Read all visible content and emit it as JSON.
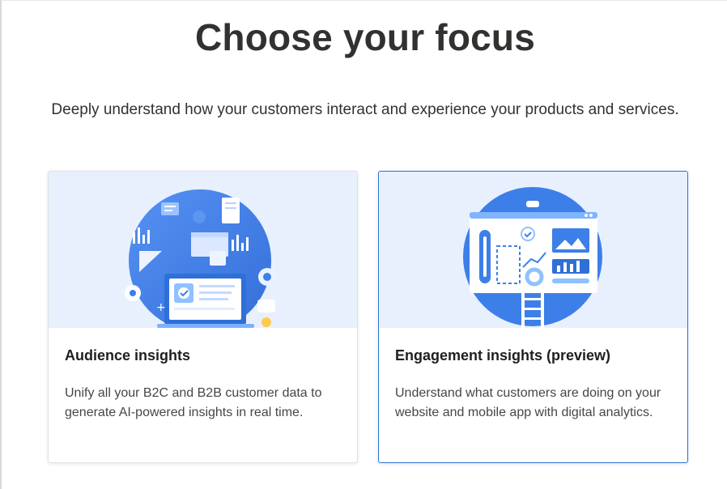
{
  "header": {
    "title": "Choose your focus",
    "subtitle": "Deeply understand how your customers interact and experience your products and services."
  },
  "cards": [
    {
      "title": "Audience insights",
      "description": "Unify all your B2C and B2B customer data to generate AI-powered insights in real time.",
      "selected": false
    },
    {
      "title": "Engagement insights (preview)",
      "description": "Understand what customers are doing on your website and mobile app with digital analytics.",
      "selected": true
    }
  ],
  "colors": {
    "accent": "#2b74d0",
    "art_background": "#e9f0fd",
    "illustration_blue": "#3d7fe8"
  },
  "icons": {
    "audience_illustration": "audience-insights-illustration",
    "engagement_illustration": "engagement-insights-illustration"
  }
}
